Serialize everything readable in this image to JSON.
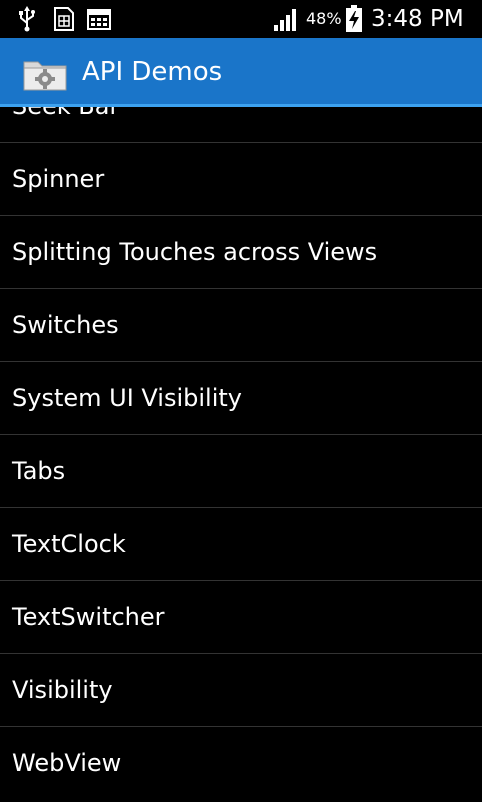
{
  "status_bar": {
    "battery_percent": "48%",
    "time": "3:48 PM",
    "icons": [
      "usb-icon",
      "sim-card-icon",
      "calendar-icon",
      "signal-icon",
      "battery-charging-icon"
    ]
  },
  "action_bar": {
    "title": "API Demos",
    "icon": "folder-gear-icon",
    "background_color": "#1a75c9"
  },
  "list": {
    "items": [
      {
        "label": "Seek Bar"
      },
      {
        "label": "Spinner"
      },
      {
        "label": "Splitting Touches across Views"
      },
      {
        "label": "Switches"
      },
      {
        "label": "System UI Visibility"
      },
      {
        "label": "Tabs"
      },
      {
        "label": "TextClock"
      },
      {
        "label": "TextSwitcher"
      },
      {
        "label": "Visibility"
      },
      {
        "label": "WebView"
      }
    ]
  }
}
